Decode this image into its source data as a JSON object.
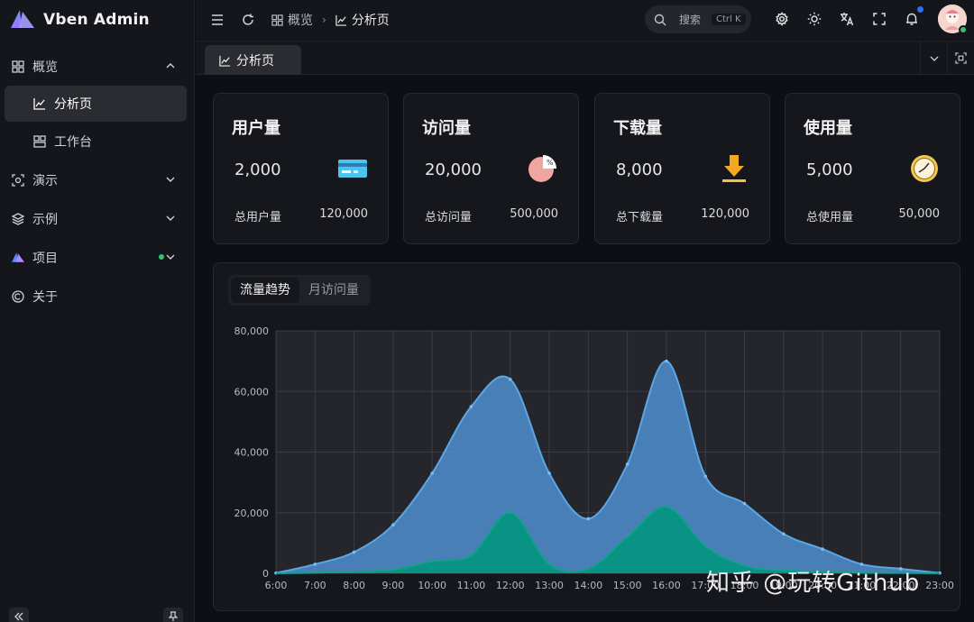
{
  "brand": {
    "title": "Vben Admin"
  },
  "sidebar": {
    "items": [
      {
        "label": "概览",
        "icon": "dashboard-icon",
        "expanded": true
      },
      {
        "label": "分析页",
        "icon": "chart-line-icon",
        "active": true
      },
      {
        "label": "工作台",
        "icon": "workspace-icon"
      },
      {
        "label": "演示",
        "icon": "demo-icon"
      },
      {
        "label": "示例",
        "icon": "layers-icon"
      },
      {
        "label": "项目",
        "icon": "vben-logo-icon",
        "badge": "dot"
      },
      {
        "label": "关于",
        "icon": "copyright-icon"
      }
    ]
  },
  "header": {
    "breadcrumb": [
      "概览",
      "分析页"
    ],
    "search": {
      "placeholder": "搜索",
      "shortcut": "Ctrl K"
    }
  },
  "tabs": [
    {
      "label": "分析页"
    }
  ],
  "cards": [
    {
      "title": "用户量",
      "value": "2,000",
      "total_label": "总用户量",
      "total": "120,000",
      "icon": "credit-card-icon"
    },
    {
      "title": "访问量",
      "value": "20,000",
      "total_label": "总访问量",
      "total": "500,000",
      "icon": "pie-percent-icon"
    },
    {
      "title": "下载量",
      "value": "8,000",
      "total_label": "总下载量",
      "total": "120,000",
      "icon": "download-icon"
    },
    {
      "title": "使用量",
      "value": "5,000",
      "total_label": "总使用量",
      "total": "50,000",
      "icon": "clock-icon"
    }
  ],
  "chart_tabs": [
    "流量趋势",
    "月访问量"
  ],
  "chart_data": {
    "type": "area",
    "x": [
      "6:00",
      "7:00",
      "8:00",
      "9:00",
      "10:00",
      "11:00",
      "12:00",
      "13:00",
      "14:00",
      "15:00",
      "16:00",
      "17:00",
      "18:00",
      "19:00",
      "20:00",
      "21:00",
      "22:00",
      "23:00"
    ],
    "series": [
      {
        "values": [
          100,
          3000,
          7000,
          16000,
          33000,
          55000,
          64000,
          33000,
          18000,
          36000,
          70000,
          32000,
          23000,
          13000,
          8000,
          3000,
          1500,
          100
        ],
        "color": "#4f8fcf"
      },
      {
        "values": [
          0,
          200,
          500,
          1200,
          4000,
          6000,
          20000,
          3000,
          1500,
          12000,
          22000,
          9000,
          2500,
          1000,
          500,
          200,
          100,
          0
        ],
        "color": "#019680"
      }
    ],
    "ylim": [
      0,
      80000
    ],
    "yticks": [
      "0",
      "20,000",
      "40,000",
      "60,000",
      "80,000"
    ],
    "grid": true
  },
  "watermark": "知乎 @玩转Github"
}
